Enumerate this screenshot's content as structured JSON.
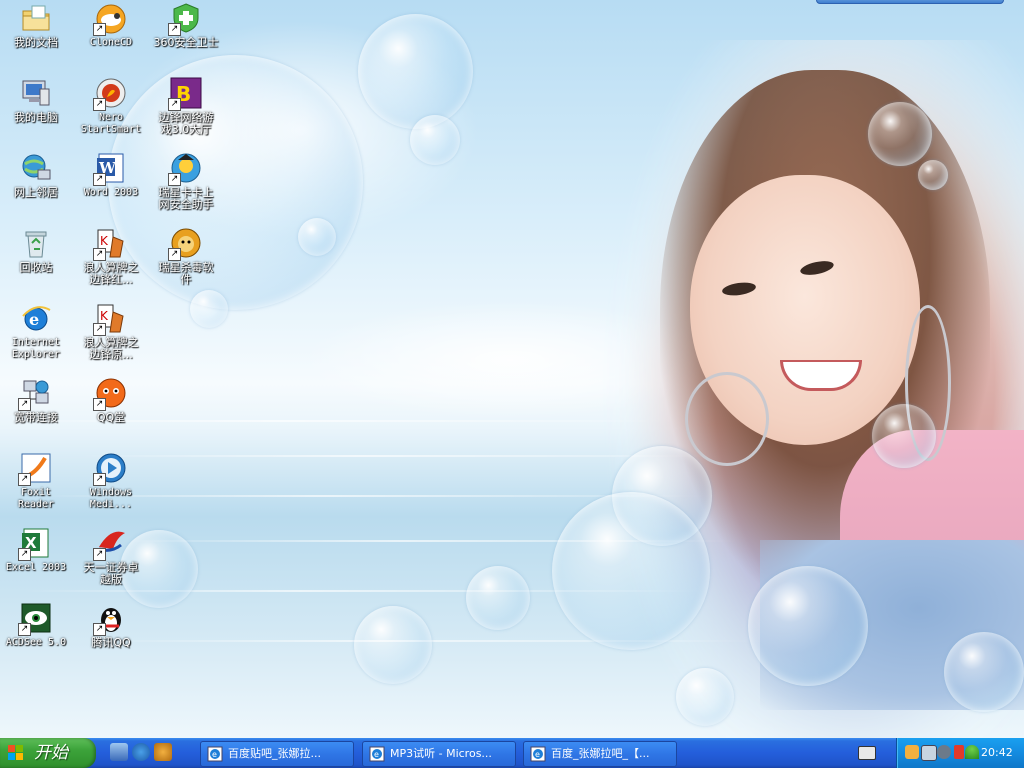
{
  "desktop": {
    "icons": [
      {
        "id": "my-documents",
        "label": "我的文档",
        "shortcut": false,
        "icon": "folder-icon"
      },
      {
        "id": "clonecd",
        "label": "CloneCD",
        "shortcut": true,
        "icon": "sheep-icon"
      },
      {
        "id": "360-safe",
        "label": "360安全卫士",
        "shortcut": true,
        "icon": "shield-plus-icon"
      },
      {
        "id": "my-computer",
        "label": "我的电脑",
        "shortcut": false,
        "icon": "computer-icon"
      },
      {
        "id": "nero-startsmart",
        "label": "Nero\nStartSmart",
        "shortcut": true,
        "icon": "nero-icon"
      },
      {
        "id": "bianfeng-game",
        "label": "边锋网络游\n戏3.0大厅",
        "shortcut": true,
        "icon": "game-hall-icon"
      },
      {
        "id": "network-places",
        "label": "网上邻居",
        "shortcut": false,
        "icon": "network-icon"
      },
      {
        "id": "word-2003",
        "label": "Word 2003",
        "shortcut": true,
        "icon": "word-icon"
      },
      {
        "id": "rising-kaka",
        "label": "瑞星卡卡上\n网安全助手",
        "shortcut": true,
        "icon": "kaka-icon"
      },
      {
        "id": "recycle-bin",
        "label": "回收站",
        "shortcut": false,
        "icon": "recycle-bin-icon"
      },
      {
        "id": "langren-red",
        "label": "浪人算牌之\n边锋红...",
        "shortcut": true,
        "icon": "cards-icon"
      },
      {
        "id": "rising-antivirus",
        "label": "瑞星杀毒软\n件",
        "shortcut": true,
        "icon": "lion-icon"
      },
      {
        "id": "internet-explorer",
        "label": "Internet\nExplorer",
        "shortcut": false,
        "icon": "ie-icon"
      },
      {
        "id": "langren-orig",
        "label": "浪人算牌之\n边锋原...",
        "shortcut": true,
        "icon": "cards-icon"
      },
      {
        "id": "broadband",
        "label": "宽带连接",
        "shortcut": true,
        "icon": "broadband-icon"
      },
      {
        "id": "qq-tang",
        "label": "QQ堂",
        "shortcut": true,
        "icon": "qqtang-icon"
      },
      {
        "id": "foxit-reader",
        "label": "Foxit\nReader",
        "shortcut": true,
        "icon": "foxit-icon"
      },
      {
        "id": "windows-media",
        "label": "Windows\nMedi...",
        "shortcut": true,
        "icon": "media-player-icon"
      },
      {
        "id": "excel-2003",
        "label": "Excel 2003",
        "shortcut": true,
        "icon": "excel-icon"
      },
      {
        "id": "tianyi-securities",
        "label": "天一证券卓\n越版",
        "shortcut": true,
        "icon": "tianyi-icon"
      },
      {
        "id": "acdsee",
        "label": "ACDSee 5.0",
        "shortcut": true,
        "icon": "eye-icon"
      },
      {
        "id": "tencent-qq",
        "label": "腾讯QQ",
        "shortcut": true,
        "icon": "penguin-icon"
      }
    ]
  },
  "taskbar": {
    "start_label": "开始",
    "quick_launch_chevron": "»",
    "tasks": [
      {
        "label": "百度贴吧_张娜拉...",
        "icon": "ie-page-icon"
      },
      {
        "label": "MP3试听 - Micros...",
        "icon": "ie-page-icon"
      },
      {
        "label": "百度_张娜拉吧_【...",
        "icon": "ie-page-icon"
      }
    ],
    "clock": "20:42"
  },
  "colors": {
    "taskbar_blue": "#245edb",
    "start_green": "#3ca33a",
    "tray_blue": "#148be0"
  }
}
